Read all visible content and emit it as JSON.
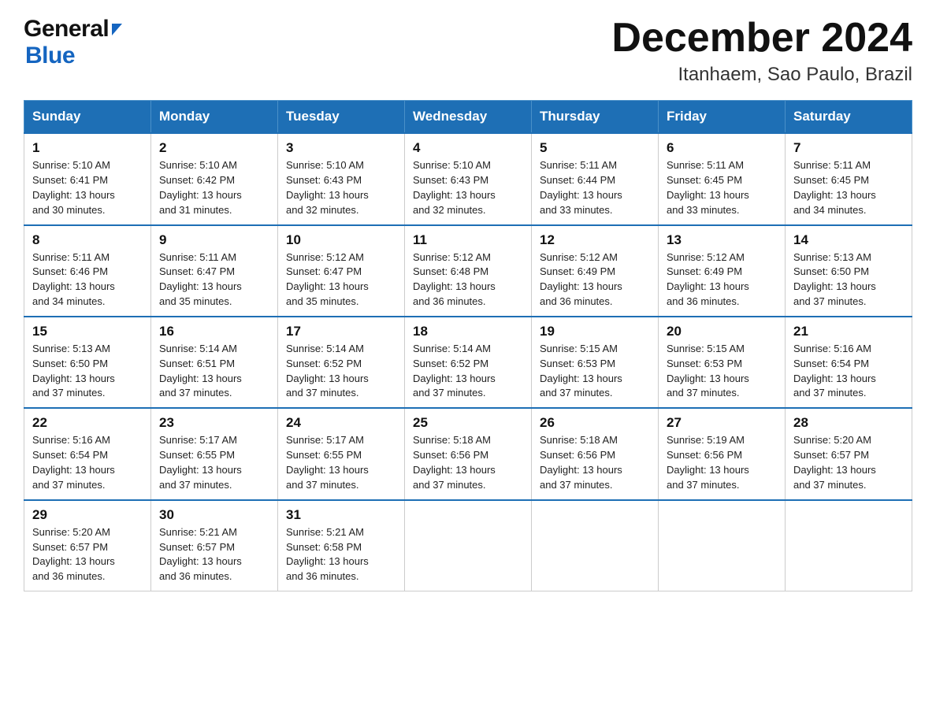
{
  "logo": {
    "general": "General",
    "blue": "Blue"
  },
  "title": {
    "month_year": "December 2024",
    "location": "Itanhaem, Sao Paulo, Brazil"
  },
  "header": {
    "days": [
      "Sunday",
      "Monday",
      "Tuesday",
      "Wednesday",
      "Thursday",
      "Friday",
      "Saturday"
    ]
  },
  "weeks": [
    [
      {
        "day": "1",
        "sunrise": "5:10 AM",
        "sunset": "6:41 PM",
        "daylight": "13 hours and 30 minutes."
      },
      {
        "day": "2",
        "sunrise": "5:10 AM",
        "sunset": "6:42 PM",
        "daylight": "13 hours and 31 minutes."
      },
      {
        "day": "3",
        "sunrise": "5:10 AM",
        "sunset": "6:43 PM",
        "daylight": "13 hours and 32 minutes."
      },
      {
        "day": "4",
        "sunrise": "5:10 AM",
        "sunset": "6:43 PM",
        "daylight": "13 hours and 32 minutes."
      },
      {
        "day": "5",
        "sunrise": "5:11 AM",
        "sunset": "6:44 PM",
        "daylight": "13 hours and 33 minutes."
      },
      {
        "day": "6",
        "sunrise": "5:11 AM",
        "sunset": "6:45 PM",
        "daylight": "13 hours and 33 minutes."
      },
      {
        "day": "7",
        "sunrise": "5:11 AM",
        "sunset": "6:45 PM",
        "daylight": "13 hours and 34 minutes."
      }
    ],
    [
      {
        "day": "8",
        "sunrise": "5:11 AM",
        "sunset": "6:46 PM",
        "daylight": "13 hours and 34 minutes."
      },
      {
        "day": "9",
        "sunrise": "5:11 AM",
        "sunset": "6:47 PM",
        "daylight": "13 hours and 35 minutes."
      },
      {
        "day": "10",
        "sunrise": "5:12 AM",
        "sunset": "6:47 PM",
        "daylight": "13 hours and 35 minutes."
      },
      {
        "day": "11",
        "sunrise": "5:12 AM",
        "sunset": "6:48 PM",
        "daylight": "13 hours and 36 minutes."
      },
      {
        "day": "12",
        "sunrise": "5:12 AM",
        "sunset": "6:49 PM",
        "daylight": "13 hours and 36 minutes."
      },
      {
        "day": "13",
        "sunrise": "5:12 AM",
        "sunset": "6:49 PM",
        "daylight": "13 hours and 36 minutes."
      },
      {
        "day": "14",
        "sunrise": "5:13 AM",
        "sunset": "6:50 PM",
        "daylight": "13 hours and 37 minutes."
      }
    ],
    [
      {
        "day": "15",
        "sunrise": "5:13 AM",
        "sunset": "6:50 PM",
        "daylight": "13 hours and 37 minutes."
      },
      {
        "day": "16",
        "sunrise": "5:14 AM",
        "sunset": "6:51 PM",
        "daylight": "13 hours and 37 minutes."
      },
      {
        "day": "17",
        "sunrise": "5:14 AM",
        "sunset": "6:52 PM",
        "daylight": "13 hours and 37 minutes."
      },
      {
        "day": "18",
        "sunrise": "5:14 AM",
        "sunset": "6:52 PM",
        "daylight": "13 hours and 37 minutes."
      },
      {
        "day": "19",
        "sunrise": "5:15 AM",
        "sunset": "6:53 PM",
        "daylight": "13 hours and 37 minutes."
      },
      {
        "day": "20",
        "sunrise": "5:15 AM",
        "sunset": "6:53 PM",
        "daylight": "13 hours and 37 minutes."
      },
      {
        "day": "21",
        "sunrise": "5:16 AM",
        "sunset": "6:54 PM",
        "daylight": "13 hours and 37 minutes."
      }
    ],
    [
      {
        "day": "22",
        "sunrise": "5:16 AM",
        "sunset": "6:54 PM",
        "daylight": "13 hours and 37 minutes."
      },
      {
        "day": "23",
        "sunrise": "5:17 AM",
        "sunset": "6:55 PM",
        "daylight": "13 hours and 37 minutes."
      },
      {
        "day": "24",
        "sunrise": "5:17 AM",
        "sunset": "6:55 PM",
        "daylight": "13 hours and 37 minutes."
      },
      {
        "day": "25",
        "sunrise": "5:18 AM",
        "sunset": "6:56 PM",
        "daylight": "13 hours and 37 minutes."
      },
      {
        "day": "26",
        "sunrise": "5:18 AM",
        "sunset": "6:56 PM",
        "daylight": "13 hours and 37 minutes."
      },
      {
        "day": "27",
        "sunrise": "5:19 AM",
        "sunset": "6:56 PM",
        "daylight": "13 hours and 37 minutes."
      },
      {
        "day": "28",
        "sunrise": "5:20 AM",
        "sunset": "6:57 PM",
        "daylight": "13 hours and 37 minutes."
      }
    ],
    [
      {
        "day": "29",
        "sunrise": "5:20 AM",
        "sunset": "6:57 PM",
        "daylight": "13 hours and 36 minutes."
      },
      {
        "day": "30",
        "sunrise": "5:21 AM",
        "sunset": "6:57 PM",
        "daylight": "13 hours and 36 minutes."
      },
      {
        "day": "31",
        "sunrise": "5:21 AM",
        "sunset": "6:58 PM",
        "daylight": "13 hours and 36 minutes."
      },
      null,
      null,
      null,
      null
    ]
  ],
  "labels": {
    "sunrise_label": "Sunrise:",
    "sunset_label": "Sunset:",
    "daylight_label": "Daylight:"
  }
}
